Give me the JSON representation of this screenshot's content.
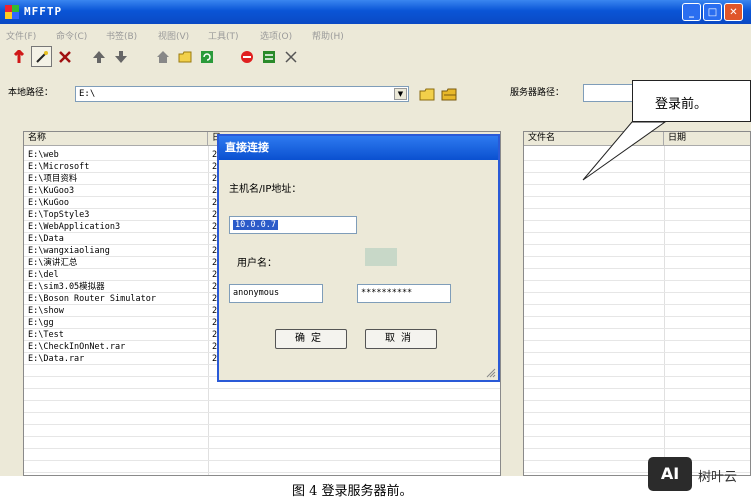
{
  "window": {
    "title": "MFFTP",
    "controls": {
      "minimize": "_",
      "maximize": "□",
      "close": "✕"
    }
  },
  "menu": [
    "文件(F)",
    "命令(C)",
    "书签(B)",
    "视图(V)",
    "工具(T)",
    "选项(O)",
    "帮助(H)"
  ],
  "toolbar": {
    "icons": [
      "connect-icon",
      "quick-connect-icon",
      "disconnect-icon",
      "upload-icon",
      "download-icon",
      "home-icon",
      "folder-icon",
      "refresh-icon",
      "stop-icon",
      "transfer-icon",
      "cancel-icon"
    ]
  },
  "local": {
    "path_label": "本地路径：",
    "path_value": "E:\\",
    "columns": [
      "名称",
      "日"
    ],
    "rows": [
      {
        "name": "E:\\web",
        "c2": "2"
      },
      {
        "name": "E:\\Microsoft",
        "c2": "2"
      },
      {
        "name": "E:\\项目资料",
        "c2": "2"
      },
      {
        "name": "E:\\KuGoo3",
        "c2": "2"
      },
      {
        "name": "E:\\KuGoo",
        "c2": "2"
      },
      {
        "name": "E:\\TopStyle3",
        "c2": "2"
      },
      {
        "name": "E:\\WebApplication3",
        "c2": "2"
      },
      {
        "name": "E:\\Data",
        "c2": "2"
      },
      {
        "name": "E:\\wangxiaoliang",
        "c2": "2"
      },
      {
        "name": "E:\\演讲汇总",
        "c2": "2"
      },
      {
        "name": "E:\\del",
        "c2": "2"
      },
      {
        "name": "E:\\sim3.05模拟器",
        "c2": "2"
      },
      {
        "name": "E:\\Boson Router Simulator",
        "c2": "2"
      },
      {
        "name": "E:\\show",
        "c2": "2"
      },
      {
        "name": "E:\\gg",
        "c2": "2"
      },
      {
        "name": "E:\\Test",
        "c2": "2"
      },
      {
        "name": "E:\\CheckInOnNet.rar",
        "c2": "2"
      },
      {
        "name": "E:\\Data.rar",
        "c2": "2"
      }
    ]
  },
  "server": {
    "path_label": "服务器路径：",
    "path_value": "",
    "columns": [
      "文件名",
      "日期"
    ]
  },
  "dialog": {
    "title": "直接连接",
    "host_label": "主机名/IP地址：",
    "host_value": "10.0.0.7",
    "user_label": "用户名：",
    "user_value": "anonymous",
    "password_value": "**********",
    "ok_label": "确定",
    "cancel_label": "取消"
  },
  "callout": "登录前。",
  "caption": "图 4 登录服务器前。",
  "watermark": {
    "logo": "AI",
    "text": "树叶云"
  }
}
